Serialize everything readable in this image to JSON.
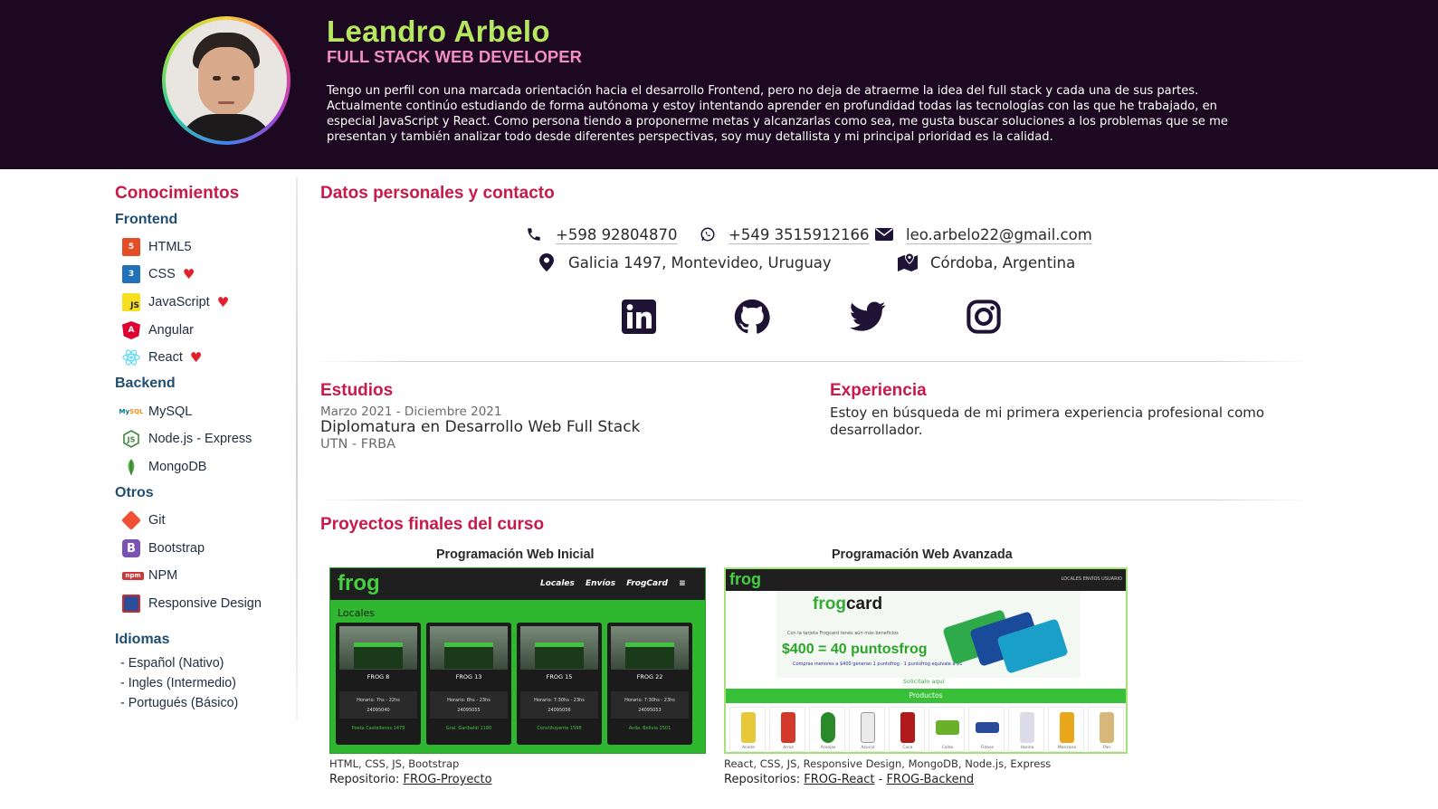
{
  "header": {
    "name": "Leandro Arbelo",
    "role": "FULL STACK WEB DEVELOPER",
    "bio": "Tengo un perfil con una marcada orientación hacia el desarrollo Frontend, pero no deja de atraerme la idea del full stack y cada una de sus partes. Actualmente continúo estudiando de forma autónoma y estoy intentando aprender en profundidad todas las tecnologías con las que he trabajado, en especial JavaScript y React. Como persona tiendo a proponerme metas y alcanzarlas como sea, me gusta buscar soluciones a los problemas que se me presentan y también analizar todo desde diferentes perspectivas, soy muy detallista y mi principal prioridad es la calidad."
  },
  "sidebar": {
    "title": "Conocimientos",
    "groups": [
      {
        "title": "Frontend",
        "items": [
          {
            "label": "HTML5",
            "icon": "html5-icon",
            "favorite": false
          },
          {
            "label": "CSS",
            "icon": "css3-icon",
            "favorite": true
          },
          {
            "label": "JavaScript",
            "icon": "javascript-icon",
            "favorite": true
          },
          {
            "label": "Angular",
            "icon": "angular-icon",
            "favorite": false
          },
          {
            "label": "React",
            "icon": "react-icon",
            "favorite": true
          }
        ]
      },
      {
        "title": "Backend",
        "items": [
          {
            "label": "MySQL",
            "icon": "mysql-icon",
            "favorite": false
          },
          {
            "label": "Node.js - Express",
            "icon": "nodejs-icon",
            "favorite": false
          },
          {
            "label": "MongoDB",
            "icon": "mongodb-icon",
            "favorite": false
          }
        ]
      },
      {
        "title": "Otros",
        "items": [
          {
            "label": "Git",
            "icon": "git-icon",
            "favorite": false
          },
          {
            "label": "Bootstrap",
            "icon": "bootstrap-icon",
            "favorite": false
          },
          {
            "label": "NPM",
            "icon": "npm-icon",
            "favorite": false
          },
          {
            "label": "Responsive Design",
            "icon": "responsive-design-icon",
            "favorite": false
          }
        ]
      }
    ],
    "languages": {
      "title": "Idiomas",
      "items": [
        "- Español (Nativo)",
        "- Ingles (Intermedio)",
        "- Portugués (Básico)"
      ]
    }
  },
  "contact": {
    "title": "Datos personales y contacto",
    "phone": "+598 92804870",
    "whatsapp": "+549 3515912166",
    "email": "leo.arbelo22@gmail.com",
    "address": "Galicia 1497, Montevideo, Uruguay",
    "origin": "Córdoba, Argentina",
    "socials": [
      "linkedin-icon",
      "github-icon",
      "twitter-icon",
      "instagram-icon"
    ]
  },
  "studies": {
    "title": "Estudios",
    "date": "Marzo 2021 - Diciembre 2021",
    "name": "Diplomatura en Desarrollo Web Full Stack",
    "institution": "UTN - FRBA"
  },
  "experience": {
    "title": "Experiencia",
    "text": "Estoy en búsqueda de mi primera experiencia profesional como desarrollador."
  },
  "projects": {
    "title": "Proyectos finales del curso",
    "p1": {
      "heading": "Programación Web Inicial",
      "tech": "HTML, CSS, JS, Bootstrap",
      "repo_label": "Repositorio: ",
      "repo_link": "FROG-Proyecto",
      "shot": {
        "logo": "frog",
        "nav": [
          "Locales",
          "Envíos",
          "FrogCard",
          "≡"
        ],
        "section": "Locales",
        "cards": [
          {
            "name": "FROG 8",
            "hours": "Horario: 7hs - 22hs",
            "phone": "24095040",
            "address": "Poeta Castellanos 1479"
          },
          {
            "name": "FROG 13",
            "hours": "Horario: 8hs - 23hs",
            "phone": "24095055",
            "address": "Gral. Garibaldi 1180"
          },
          {
            "name": "FROG 15",
            "hours": "Horario: 7:30hs - 23hs",
            "phone": "24095056",
            "address": "Constituyente 1598"
          },
          {
            "name": "FROG 22",
            "hours": "Horario: 7:30hs - 23hs",
            "phone": "24095053",
            "address": "Avda. Bolivia 1501"
          }
        ]
      }
    },
    "p2": {
      "heading": "Programación Web Avanzada",
      "tech": "React, CSS, JS, Responsive Design, MongoDB, Node.js, Express",
      "repo_label": "Repositorios: ",
      "repo_link1": "FROG-React",
      "repo_sep": " - ",
      "repo_link2": "FROG-Backend",
      "shot": {
        "logo": "frog",
        "nav": "LOCALES  ENVÍOS  USUARIO",
        "brand_a": "frog",
        "brand_b": "card",
        "promo_small": "Con la tarjeta Frogcard tenés aún más beneficios",
        "promo": "$400 = 40 puntosfrog",
        "promo_note": "Compras menores a $400 generan 1 puntofrog · 1 puntofrog equivale a $1",
        "cta": "Solicitalo aquí",
        "products_label": "Productos",
        "products": [
          "Aceite",
          "Arroz",
          "Arvejas",
          "Azúcar",
          "Coca",
          "Caldo",
          "Fideos",
          "Harina",
          "Manzana",
          "Pan"
        ]
      }
    }
  },
  "colors": {
    "header_bg": "#1c0820",
    "name": "#b6e85f",
    "role": "#f28ec0",
    "section_title": "#c9184a",
    "group_title": "#1f4e70",
    "heart": "#e0202a"
  }
}
